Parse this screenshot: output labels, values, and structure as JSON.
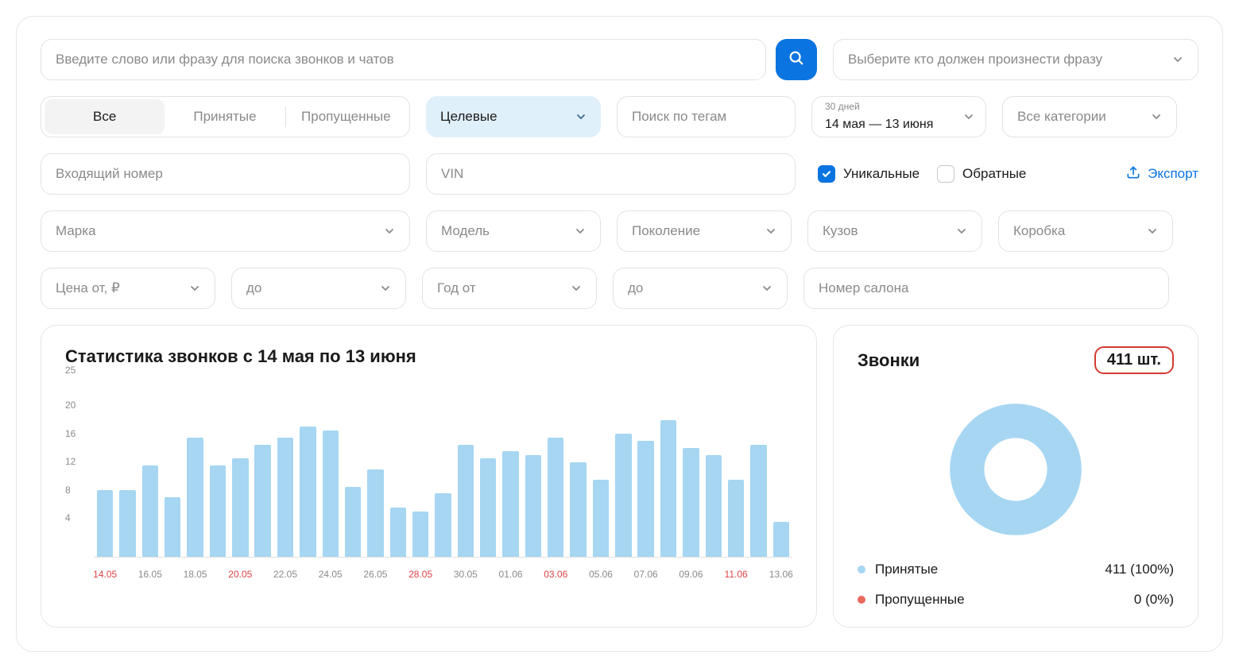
{
  "search": {
    "placeholder": "Введите слово или фразу для поиска звонков и чатов",
    "speaker_placeholder": "Выберите кто должен произнести фразу"
  },
  "tabs": {
    "items": [
      "Все",
      "Принятые",
      "Пропущенные"
    ],
    "active_index": 0
  },
  "target_select": {
    "label": "Целевые"
  },
  "tags_input": {
    "placeholder": "Поиск по тегам"
  },
  "date_select": {
    "caption": "30 дней",
    "range": "14 мая — 13 июня"
  },
  "categories_select": {
    "label": "Все категории"
  },
  "incoming_input": {
    "placeholder": "Входящий номер"
  },
  "vin_input": {
    "placeholder": "VIN"
  },
  "options": {
    "unique": {
      "label": "Уникальные",
      "checked": true
    },
    "return": {
      "label": "Обратные",
      "checked": false
    },
    "export_label": "Экспорт"
  },
  "filters": {
    "brand": "Марка",
    "model": "Модель",
    "generation": "Поколение",
    "body": "Кузов",
    "gearbox": "Коробка",
    "price_from": "Цена от, ₽",
    "price_to": "до",
    "year_from": "Год от",
    "year_to": "до",
    "salon_number": "Номер салона"
  },
  "stats": {
    "title": "Статистика звонков с 14 мая по 13 июня"
  },
  "calls": {
    "title": "Звонки",
    "total_label": "411 шт.",
    "legend": {
      "accepted": {
        "label": "Принятые",
        "value": "411 (100%)",
        "color": "#a6d6f2"
      },
      "missed": {
        "label": "Пропущенные",
        "value": "0 (0%)",
        "color": "#e76a5e"
      }
    }
  },
  "chart_data": {
    "type": "bar",
    "title": "Статистика звонков с 14 мая по 13 июня",
    "xlabel": "",
    "ylabel": "",
    "ylim": [
      0,
      25
    ],
    "y_ticks": [
      4,
      8,
      12,
      16,
      20,
      25
    ],
    "x_tick_labels": [
      "14.05",
      "16.05",
      "18.05",
      "20.05",
      "22.05",
      "24.05",
      "26.05",
      "28.05",
      "30.05",
      "01.06",
      "03.06",
      "05.06",
      "07.06",
      "09.06",
      "11.06",
      "13.06"
    ],
    "weekend_indices": [
      0,
      6,
      7,
      13,
      14,
      20,
      21,
      27,
      28
    ],
    "categories": [
      "14.05",
      "15.05",
      "16.05",
      "17.05",
      "18.05",
      "19.05",
      "20.05",
      "21.05",
      "22.05",
      "23.05",
      "24.05",
      "25.05",
      "26.05",
      "27.05",
      "28.05",
      "29.05",
      "30.05",
      "31.05",
      "01.06",
      "02.06",
      "03.06",
      "04.06",
      "05.06",
      "06.06",
      "07.06",
      "08.06",
      "09.06",
      "10.06",
      "11.06",
      "12.06",
      "13.06"
    ],
    "values": [
      9.5,
      9.5,
      13,
      8.5,
      17,
      13,
      14,
      16,
      17,
      18.5,
      18,
      10,
      12.5,
      7,
      6.5,
      9,
      16,
      14,
      15,
      14.5,
      17,
      13.5,
      11,
      17.5,
      16.5,
      19.5,
      15.5,
      14.5,
      11,
      16,
      5
    ]
  }
}
